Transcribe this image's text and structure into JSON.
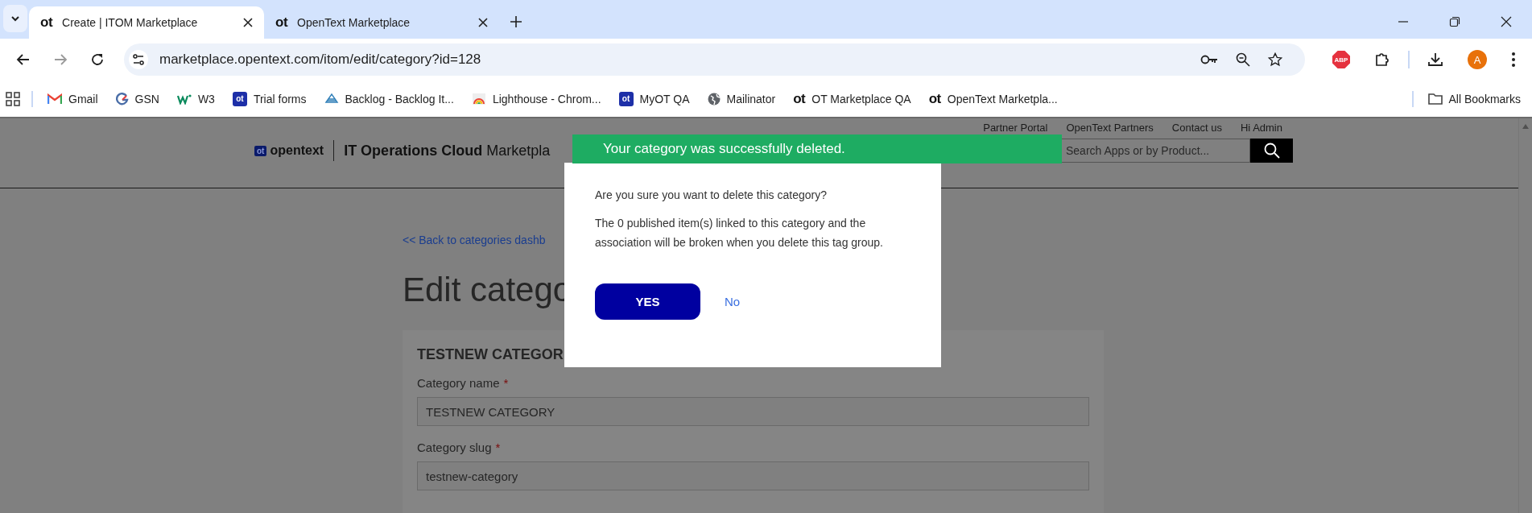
{
  "browser": {
    "tabs": [
      {
        "icon_text": "ot",
        "title": "Create | ITOM Marketplace",
        "selected": true
      },
      {
        "icon_text": "ot",
        "title": "OpenText Marketplace",
        "selected": false
      }
    ],
    "url": "marketplace.opentext.com/itom/edit/category?id=128",
    "extension_badge": "ABP",
    "profile_initial": "A",
    "bookmarks": [
      {
        "kind": "gmail",
        "label": "Gmail"
      },
      {
        "kind": "gsn",
        "label": "GSN"
      },
      {
        "kind": "w3",
        "label": "W3"
      },
      {
        "kind": "ot-badge",
        "icon_text": "ot",
        "label": "Trial forms"
      },
      {
        "kind": "backlog",
        "label": "Backlog - Backlog It..."
      },
      {
        "kind": "lighthouse",
        "label": "Lighthouse - Chrom..."
      },
      {
        "kind": "ot-badge",
        "icon_text": "ot",
        "label": "MyOT QA"
      },
      {
        "kind": "globe",
        "label": "Mailinator"
      },
      {
        "kind": "ot",
        "icon_text": "ot",
        "label": "OT Marketplace QA"
      },
      {
        "kind": "ot",
        "icon_text": "ot",
        "label": "OpenText Marketpla..."
      }
    ],
    "all_bookmarks": "All Bookmarks"
  },
  "site": {
    "top_links": [
      "Partner Portal",
      "OpenText Partners",
      "Contact us",
      "Hi Admin"
    ],
    "logo": {
      "badge": "ot",
      "word": "opentext"
    },
    "product": "**IT Operations Cloud** Marketpla",
    "search": {
      "placeholder": "Search Apps or by Product..."
    },
    "back_link": "<< Back to categories dashb",
    "title": "Edit catego",
    "card_heading": "TESTNEW CATEGOR",
    "fields": [
      {
        "label": "Category name",
        "required": true,
        "required_mark": "*",
        "value": "TESTNEW CATEGORY"
      },
      {
        "label": "Category slug",
        "required": true,
        "required_mark": "*",
        "value": "testnew-category"
      }
    ]
  },
  "dialog": {
    "question": "Are you sure you want to delete this category?",
    "message": "The 0 published item(s) linked to this category and the association will be broken when you delete this tag group.",
    "yes": "YES",
    "no": "No"
  },
  "toast": {
    "message": "Your category was successfully deleted."
  }
}
